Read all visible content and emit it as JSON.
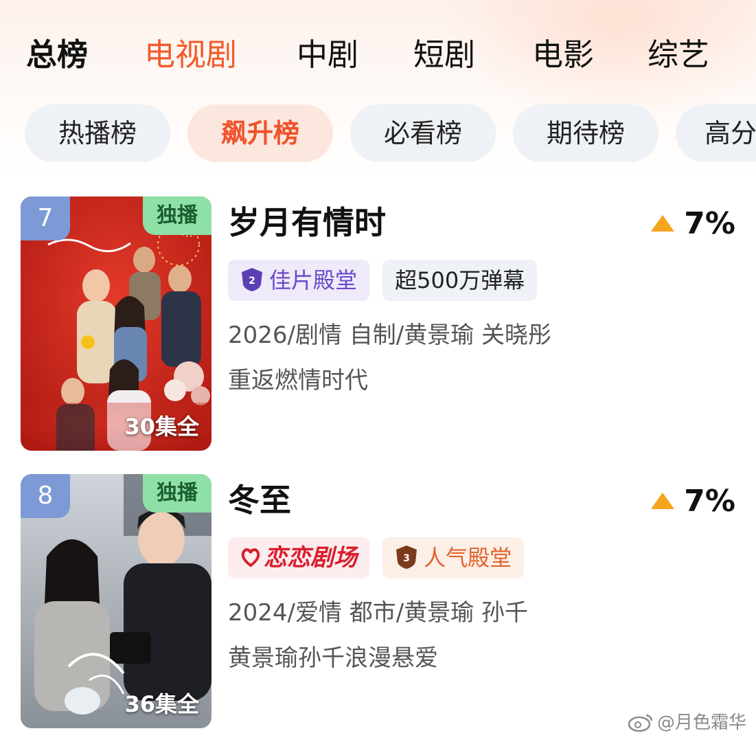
{
  "main_tabs": [
    {
      "label": "总榜"
    },
    {
      "label": "电视剧"
    },
    {
      "label": "中剧"
    },
    {
      "label": "短剧"
    },
    {
      "label": "电影"
    },
    {
      "label": "综艺"
    }
  ],
  "sub_tabs": [
    {
      "label": "热播榜"
    },
    {
      "label": "飙升榜"
    },
    {
      "label": "必看榜"
    },
    {
      "label": "期待榜"
    },
    {
      "label": "高分"
    }
  ],
  "items": [
    {
      "rank": "7",
      "exclusive_tag": "独播",
      "episodes": "30集全",
      "title": "岁月有情时",
      "trend": "7%",
      "badges": [
        {
          "text": "佳片殿堂",
          "icon": "hall-of-fame-2-shield-icon"
        },
        {
          "text": "超500万弹幕"
        }
      ],
      "meta": "2026/剧情 自制/黄景瑜 关晓彤",
      "description": "重返燃情时代"
    },
    {
      "rank": "8",
      "exclusive_tag": "独播",
      "episodes": "36集全",
      "title": "冬至",
      "trend": "7%",
      "badges": [
        {
          "text": "恋恋剧场",
          "icon": "heart-logo-icon"
        },
        {
          "text": "人气殿堂",
          "icon": "hall-of-fame-3-shield-icon"
        }
      ],
      "meta": "2024/爱情 都市/黄景瑜 孙千",
      "description": "黄景瑜孙千浪漫悬爱"
    }
  ],
  "watermark": "@月色霜华",
  "colors": {
    "accent": "#f25a2a",
    "trend_up": "#f4a41d",
    "rank_badge": "#7d9ad6",
    "exclusive_badge": "#8fe0a6"
  }
}
